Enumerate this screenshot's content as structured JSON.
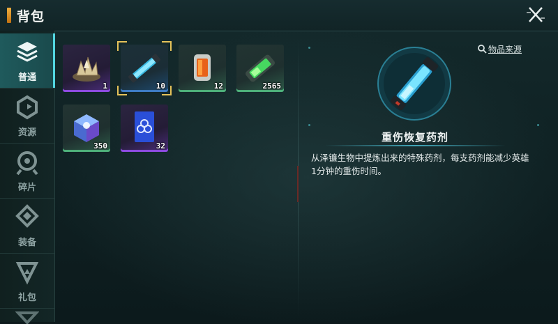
{
  "header": {
    "title": "背包"
  },
  "tabs": [
    {
      "label": "普通",
      "icon": "layers-icon",
      "active": true
    },
    {
      "label": "资源",
      "icon": "resource-icon",
      "active": false
    },
    {
      "label": "碎片",
      "icon": "fragment-icon",
      "active": false
    },
    {
      "label": "装备",
      "icon": "equipment-icon",
      "active": false
    },
    {
      "label": "礼包",
      "icon": "gift-icon",
      "active": false
    }
  ],
  "items": [
    {
      "name": "crystal-cluster",
      "count": "1",
      "rarity": "purple"
    },
    {
      "name": "重伤恢复药剂",
      "count": "10",
      "rarity": "blue",
      "selected": true
    },
    {
      "name": "energy-canister",
      "count": "12",
      "rarity": "green"
    },
    {
      "name": "green-cell",
      "count": "2565",
      "rarity": "green"
    },
    {
      "name": "light-cube",
      "count": "350",
      "rarity": "green"
    },
    {
      "name": "blueprint-card",
      "count": "32",
      "rarity": "purple"
    }
  ],
  "detail": {
    "source_link": "物品来源",
    "item_name": "重伤恢复药剂",
    "description": "从泽镰生物中提炼出来的特殊药剂，每支药剂能减少英雄1分钟的重伤时间。"
  },
  "colors": {
    "accent": "#52d6e0",
    "selected": "#e6c35a",
    "purple": "#8d4be0",
    "blue": "#3e7cc4",
    "green": "#4eb07a"
  }
}
